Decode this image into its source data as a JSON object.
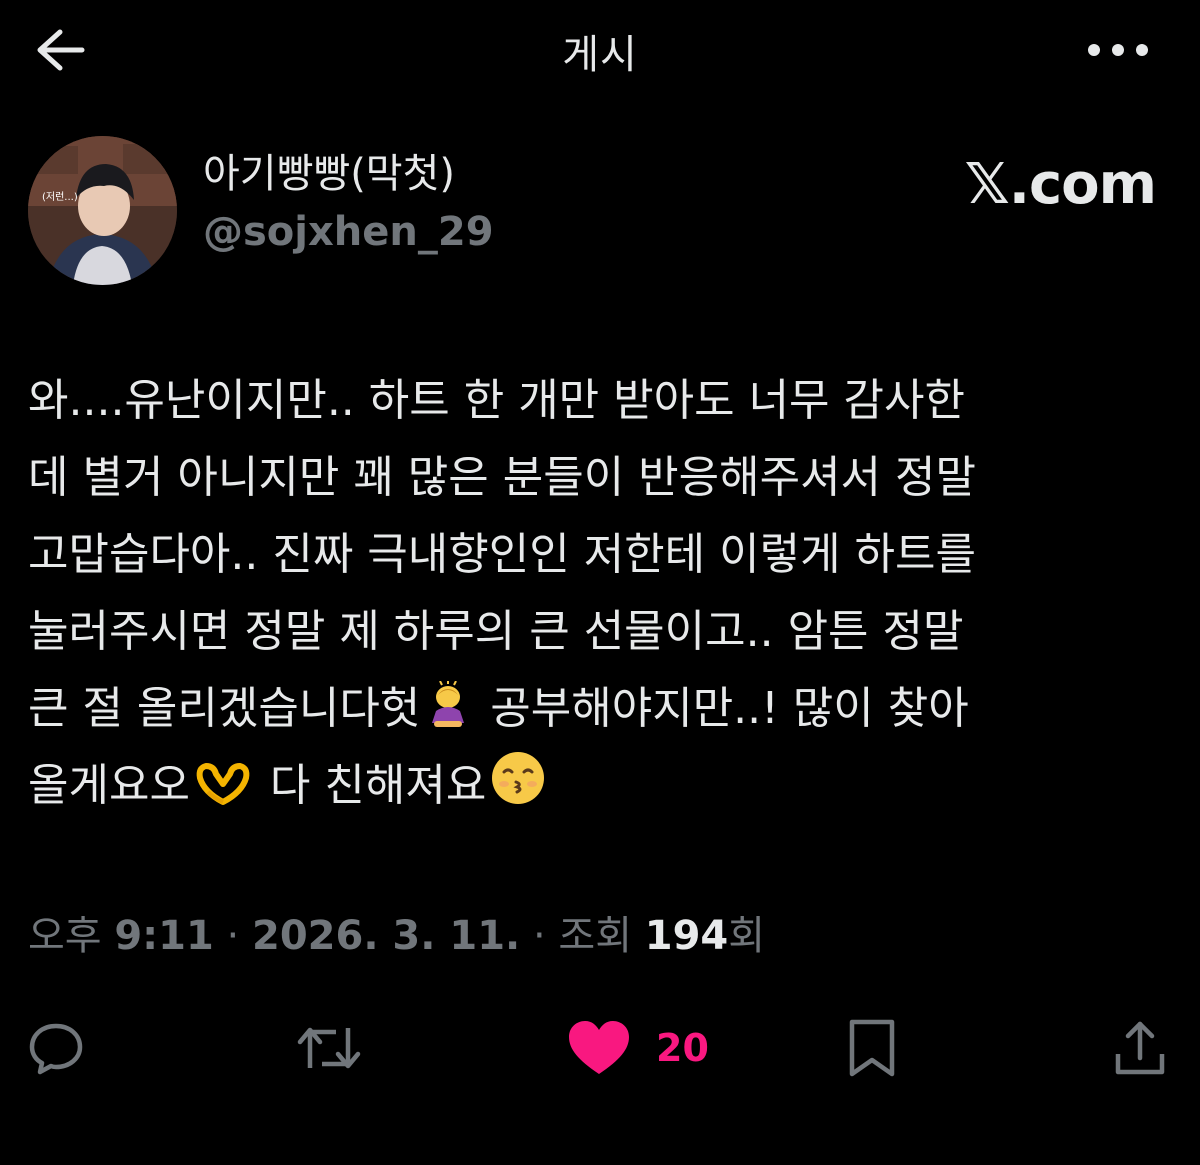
{
  "header": {
    "title": "게시"
  },
  "author": {
    "display_name": "아기빵빵(막첫)",
    "handle": "@sojxhen_29",
    "avatar_caption": "(저런...)"
  },
  "watermark": "𝕏.com",
  "tweet": {
    "lines": [
      "와....유난이지만.. 하트 한 개만 받아도 너무 감사한",
      "데 별거 아니지만 꽤 많은 분들이 반응해주셔서 정말",
      "고맙습다아.. 진짜 극내향인인 저한테 이렇게 하트를",
      "눌러주시면 정말 제 하루의 큰 선물이고.. 암튼 정말"
    ],
    "line5_a": "큰 절 올리겠습니다헛",
    "line5_b": "공부해야지만..! 많이 찾아",
    "line6_a": "올게요오",
    "line6_b": "다 친해져요"
  },
  "meta": {
    "time_prefix": "오후 ",
    "time": "9:11",
    "sep": " · ",
    "date": "2026. 3. 11.",
    "views_label": "조회 ",
    "views": "194",
    "views_suffix": "회"
  },
  "actions": {
    "like_count": "20"
  },
  "colors": {
    "background": "#000000",
    "text": "#e7e9ea",
    "muted": "#71767b",
    "like": "#f91880"
  },
  "icons": [
    "back-arrow-icon",
    "more-icon",
    "reply-icon",
    "retweet-icon",
    "heart-icon",
    "bookmark-icon",
    "share-icon"
  ]
}
